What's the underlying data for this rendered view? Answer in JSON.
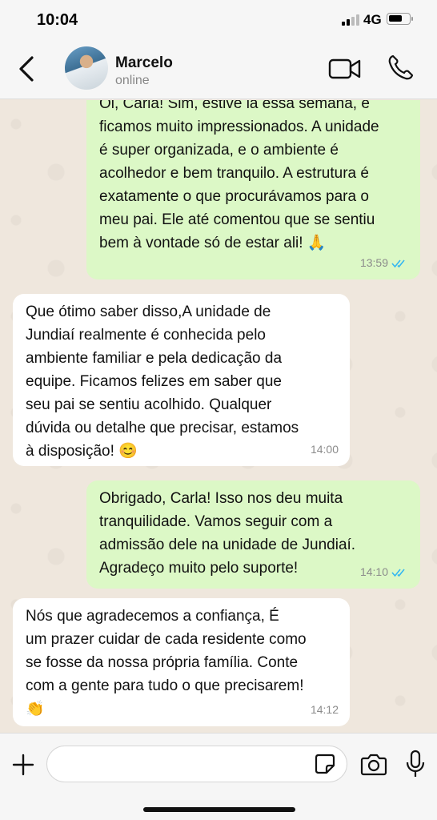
{
  "status_bar": {
    "time": "10:04",
    "network": "4G",
    "battery_level": 0.7
  },
  "header": {
    "contact_name": "Marcelo",
    "contact_status": "online"
  },
  "messages": [
    {
      "direction": "out",
      "text": "Oi, Carla! Sim, estive lá essa semana, e\nficamos muito impressionados. A unidade\né super organizada, e o ambiente é\nacolhedor e bem tranquilo. A estrutura é\nexatamente o que procurávamos para o\nmeu pai. Ele até comentou que se sentiu\nbem à vontade só de estar ali! 🙏",
      "time": "13:59",
      "read": true
    },
    {
      "direction": "in",
      "text": "Que ótimo saber disso,A unidade de\nJundiaí realmente é conhecida pelo\nambiente familiar e pela dedicação da\nequipe. Ficamos felizes em saber que\nseu pai se sentiu acolhido. Qualquer\ndúvida ou detalhe que precisar, estamos\nà disposição! 😊",
      "time": "14:00"
    },
    {
      "direction": "out",
      "text": "Obrigado, Carla! Isso nos deu muita\ntranquilidade. Vamos seguir com a\nadmissão dele na unidade de Jundiaí.\nAgradeço muito pelo suporte!",
      "time": "14:10",
      "read": true
    },
    {
      "direction": "in",
      "text": "Nós que agradecemos a confiança,  É\num prazer cuidar de cada residente como\nse fosse da nossa própria família. Conte\ncom a gente para tudo o que precisarem!\n👏",
      "time": "14:12"
    }
  ],
  "composer": {
    "placeholder": ""
  },
  "colors": {
    "outgoing_bubble": "#dcf8c6",
    "incoming_bubble": "#ffffff",
    "read_ticks": "#34b7f1",
    "chat_background": "#efe7dd"
  }
}
